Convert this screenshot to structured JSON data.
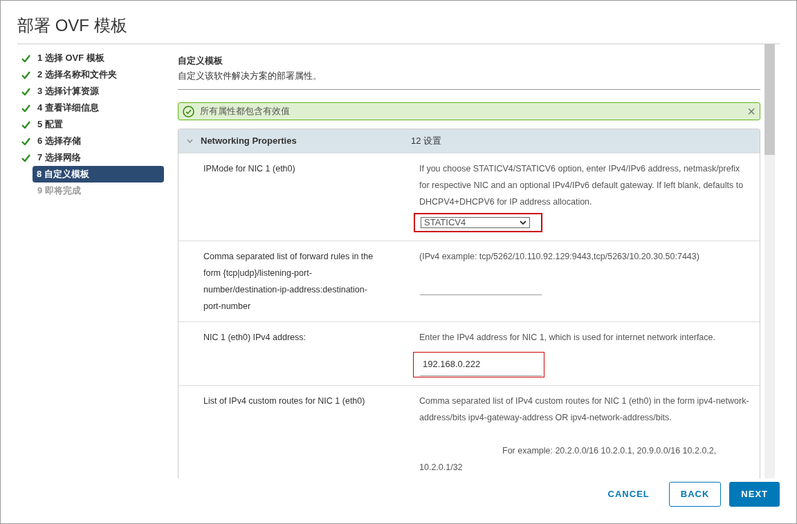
{
  "window": {
    "title": "部署 OVF 模板"
  },
  "steps": [
    {
      "label": "1 选择 OVF 模板",
      "completed": true,
      "selected": false,
      "disabled": false
    },
    {
      "label": "2 选择名称和文件夹",
      "completed": true,
      "selected": false,
      "disabled": false
    },
    {
      "label": "3 选择计算资源",
      "completed": true,
      "selected": false,
      "disabled": false
    },
    {
      "label": "4 查看详细信息",
      "completed": true,
      "selected": false,
      "disabled": false
    },
    {
      "label": "5 配置",
      "completed": true,
      "selected": false,
      "disabled": false
    },
    {
      "label": "6 选择存储",
      "completed": true,
      "selected": false,
      "disabled": false
    },
    {
      "label": "7 选择网络",
      "completed": true,
      "selected": false,
      "disabled": false
    },
    {
      "label": "8 自定义模板",
      "completed": false,
      "selected": true,
      "disabled": false
    },
    {
      "label": "9 即将完成",
      "completed": false,
      "selected": false,
      "disabled": true
    }
  ],
  "page": {
    "title": "自定义模板",
    "subtitle": "自定义该软件解决方案的部署属性。"
  },
  "alert": {
    "text": "所有属性都包含有效值",
    "close": "×"
  },
  "group": {
    "title": "Networking Properties",
    "count": "12 设置",
    "expanded": true,
    "properties": [
      {
        "label": "IPMode for NIC 1 (eth0)",
        "paragraphs": [
          {
            "kind": "plain",
            "text": "If you choose STATICV4/STATICV6 option, enter IPv4/IPv6 address, netmask/prefix for respective NIC and an optional IPv4/IPv6 default gateway. If left blank, defaults to DHCPV4+DHCPV6 for IP address allocation."
          }
        ],
        "field": {
          "kind": "select",
          "value": "STATICV4",
          "highlighted": true
        }
      },
      {
        "label": "Comma separated list of forward rules in the form {tcp|udp}/listening-port-number/destination-ip-address:destination-port-number",
        "paragraphs": [
          {
            "kind": "plain",
            "text": "(IPv4 example: tcp/5262/10.110.92.129:9443,tcp/5263/10.20.30.50:7443)"
          }
        ],
        "field": {
          "kind": "text",
          "highlighted": false
        }
      },
      {
        "label": "NIC 1 (eth0) IPv4 address:",
        "paragraphs": [
          {
            "kind": "plain",
            "text": "Enter the IPv4 address for NIC 1, which is used for internet network interface."
          }
        ],
        "field": {
          "kind": "text",
          "value": "192.168.0.222",
          "highlighted": true
        }
      },
      {
        "label": "List of IPv4 custom routes for NIC 1 (eth0)",
        "paragraphs": [
          {
            "kind": "plain",
            "text": "Comma separated list of IPv4 custom routes for NIC 1 (eth0) in the form ipv4-network-address/bits ipv4-gateway-address OR ipv4-network-address/bits."
          },
          {
            "kind": "example",
            "text": "For example: 20.2.0.0/16 10.2.0.1, 20.9.0.0/16 10.2.0.2, 10.2.0.1/32"
          }
        ]
      }
    ]
  },
  "buttons": [
    {
      "kind": "flat",
      "label": "CANCEL"
    },
    {
      "kind": "outline",
      "label": "BACK"
    },
    {
      "kind": "primary",
      "label": "NEXT"
    }
  ]
}
